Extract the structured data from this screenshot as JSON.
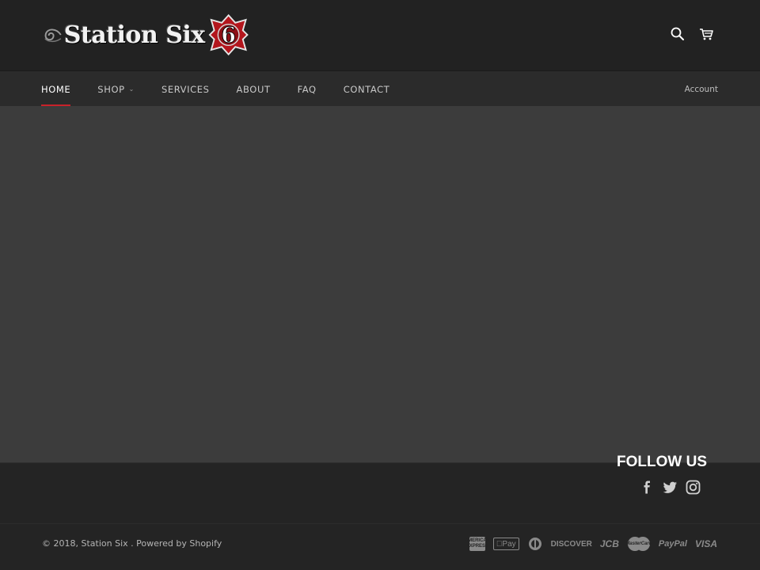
{
  "header": {
    "logo_text": "Station Six",
    "logo_badge_number": "6",
    "icons": [
      "search-icon",
      "cart-icon"
    ]
  },
  "nav": {
    "items": [
      {
        "label": "HOME",
        "active": true
      },
      {
        "label": "SHOP",
        "dropdown": true
      },
      {
        "label": "SERVICES"
      },
      {
        "label": "ABOUT"
      },
      {
        "label": "FAQ"
      },
      {
        "label": "CONTACT"
      }
    ],
    "account_label": "Account",
    "active_color": "#c8222a"
  },
  "footer": {
    "follow_title": "FOLLOW US",
    "social_icons": [
      "facebook-icon",
      "twitter-icon",
      "instagram-icon"
    ],
    "copyright": "© 2018, Station Six . Powered by Shopify",
    "payments": {
      "amex": "AMERICAN EXPRESS",
      "apple_pay": "Pay",
      "discover": "DISCOVER",
      "jcb": "JCB",
      "mastercard": "MasterCard",
      "paypal": "PayPal",
      "visa": "VISA"
    }
  },
  "colors": {
    "header_bg": "#222222",
    "nav_bg": "#2b2b2b",
    "hero_bg": "#3c3c3c",
    "footer_bg": "#242424"
  }
}
